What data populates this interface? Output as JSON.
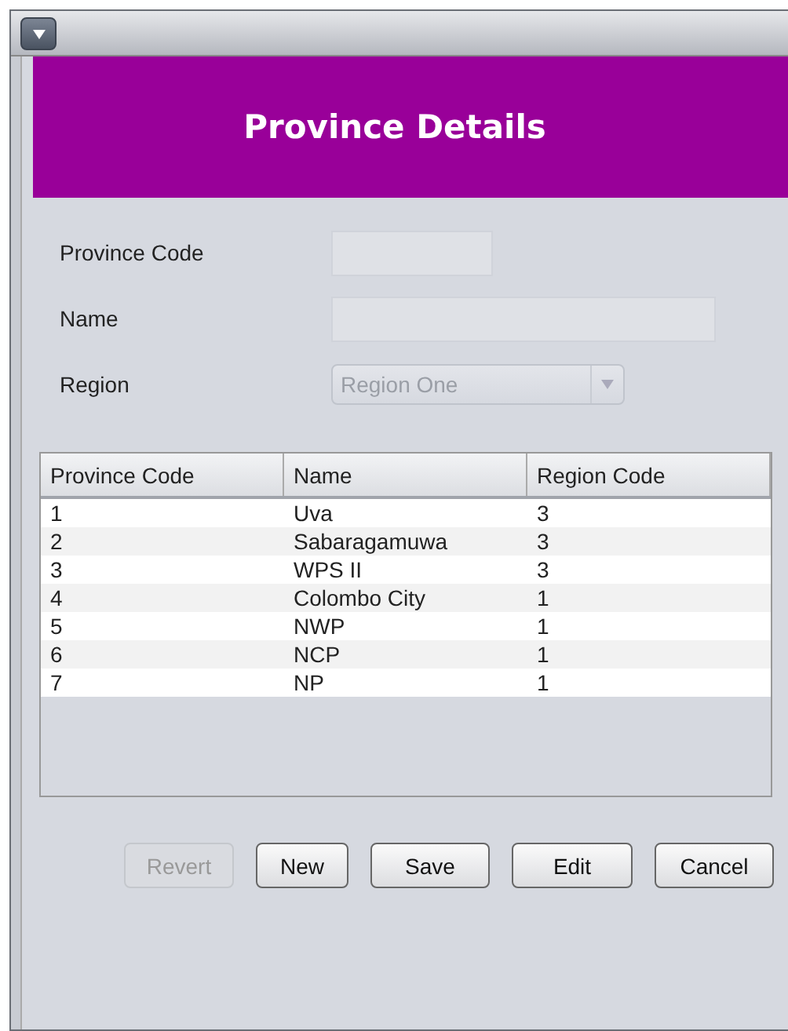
{
  "window": {
    "title": "Province Details"
  },
  "form": {
    "fields": [
      {
        "kind": "text",
        "label": "Province Code",
        "disabled": true
      },
      {
        "kind": "text",
        "label": "Name",
        "disabled": true
      },
      {
        "kind": "combo",
        "label": "Region",
        "value": "Region One",
        "disabled": true
      }
    ]
  },
  "table": {
    "columns": [
      "Province Code",
      "Name",
      "Region Code"
    ],
    "rows": [
      [
        "1",
        "Uva",
        "3"
      ],
      [
        "2",
        "Sabaragamuwa",
        "3"
      ],
      [
        "3",
        "WPS II",
        "3"
      ],
      [
        "4",
        "Colombo City",
        "1"
      ],
      [
        "5",
        "NWP",
        "1"
      ],
      [
        "6",
        "NCP",
        "1"
      ],
      [
        "7",
        "NP",
        "1"
      ]
    ]
  },
  "buttons": [
    {
      "label": "Revert",
      "disabled": true
    },
    {
      "label": "New",
      "disabled": false
    },
    {
      "label": "Save",
      "disabled": false
    },
    {
      "label": "Edit",
      "disabled": false
    },
    {
      "label": "Cancel",
      "disabled": false
    }
  ]
}
